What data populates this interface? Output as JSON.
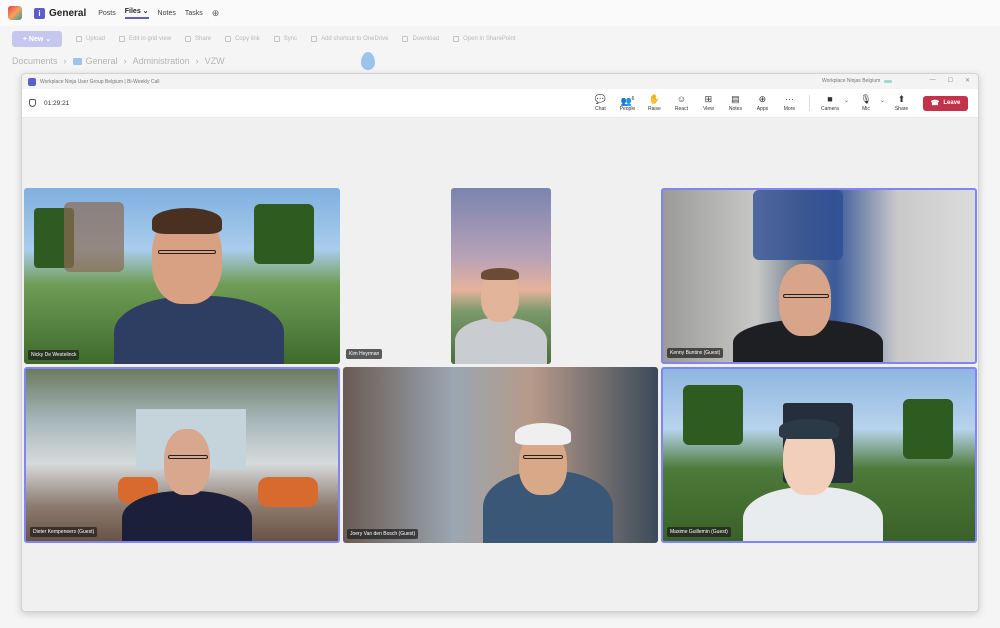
{
  "channel": {
    "name": "General",
    "tabs": [
      {
        "label": "Posts"
      },
      {
        "label": "Files"
      },
      {
        "label": "Notes"
      },
      {
        "label": "Tasks"
      }
    ],
    "add_tab": "⊕"
  },
  "files_toolbar": {
    "new_label": "+ New",
    "items": [
      "Upload",
      "Edit in grid view",
      "Share",
      "Copy link",
      "Sync",
      "Add shortcut to OneDrive",
      "Download",
      "Open in SharePoint"
    ]
  },
  "breadcrumb": [
    "Documents",
    "General",
    "Administration",
    "VZW"
  ],
  "meeting_window": {
    "title": "Workplace Ninja User Group Belgium | Bi-Weekly Call",
    "org": "Workplace Ninjas Belgium",
    "timer": "01:29:21"
  },
  "controls": [
    {
      "label": "Chat",
      "icon": "chat-icon"
    },
    {
      "label": "People",
      "icon": "people-icon",
      "count": "6"
    },
    {
      "label": "Raise",
      "icon": "raise-hand-icon"
    },
    {
      "label": "React",
      "icon": "react-icon"
    },
    {
      "label": "View",
      "icon": "view-icon"
    },
    {
      "label": "Notes",
      "icon": "notes-icon"
    },
    {
      "label": "Apps",
      "icon": "apps-icon"
    },
    {
      "label": "More",
      "icon": "more-icon"
    },
    {
      "label": "Camera",
      "icon": "camera-icon"
    },
    {
      "label": "Mic",
      "icon": "mic-icon"
    },
    {
      "label": "Share",
      "icon": "share-icon"
    }
  ],
  "leave_label": "Leave",
  "participants": [
    {
      "name": "Nicky De Westelinck"
    },
    {
      "name": "Kim Heyrman"
    },
    {
      "name": "Kenny Buntinx (Guest)"
    },
    {
      "name": "Dieter Kempeneers (Guest)"
    },
    {
      "name": "Joery Van den Bosch (Guest)"
    },
    {
      "name": "Maxime Guillemin (Guest)"
    }
  ],
  "colors": {
    "accent": "#5b5fc7",
    "leave": "#c4314b",
    "active_speaker_border": "#7f85f5"
  }
}
